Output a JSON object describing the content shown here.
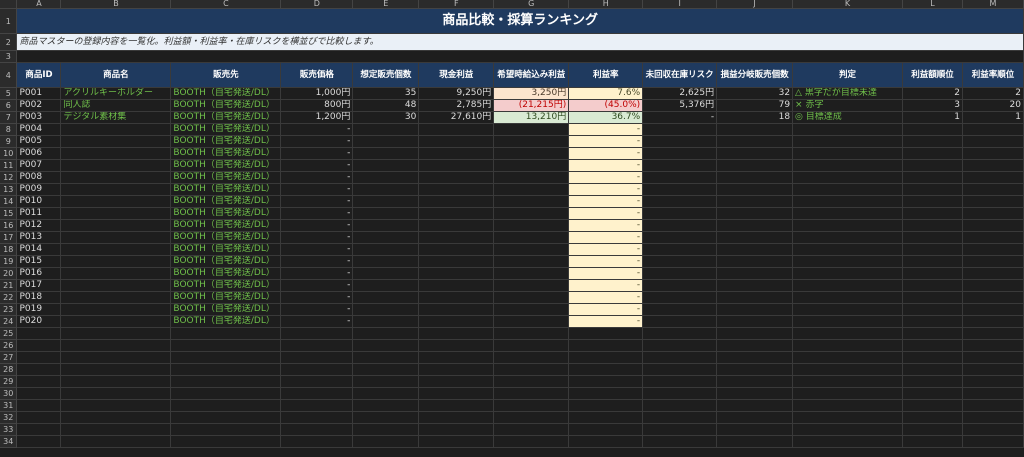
{
  "columns": [
    "A",
    "B",
    "C",
    "D",
    "E",
    "F",
    "G",
    "H",
    "I",
    "J",
    "K",
    "L",
    "M"
  ],
  "title": "商品比較・採算ランキング",
  "description": "商品マスターの登録内容を一覧化。利益額・利益率・在庫リスクを横並びで比較します。",
  "headers": [
    "商品ID",
    "商品名",
    "販売先",
    "販売価格",
    "想定販売個数",
    "現金利益",
    "希望時給込み利益",
    "利益率",
    "未回収在庫リスク",
    "損益分岐販売個数",
    "判定",
    "利益額順位",
    "利益率順位"
  ],
  "rows": [
    {
      "id": "P001",
      "name": "アクリルキーホルダー",
      "channel": "BOOTH（自宅発送/DL）",
      "price": "1,000円",
      "qty": "35",
      "cash": "9,250円",
      "wage": "3,250円",
      "rate": "7.6%",
      "risk": "2,625円",
      "be": "32",
      "judge": "△ 黒字だが目標未達",
      "r1": "2",
      "r2": "2"
    },
    {
      "id": "P002",
      "name": "同人誌",
      "channel": "BOOTH（自宅発送/DL）",
      "price": "800円",
      "qty": "48",
      "cash": "2,785円",
      "wage": "(21,215円)",
      "rate": "(45.0%)",
      "risk": "5,376円",
      "be": "79",
      "judge": "× 赤字",
      "r1": "3",
      "r2": "20"
    },
    {
      "id": "P003",
      "name": "デジタル素材集",
      "channel": "BOOTH（自宅発送/DL）",
      "price": "1,200円",
      "qty": "30",
      "cash": "27,610円",
      "wage": "13,210円",
      "rate": "36.7%",
      "risk": "-",
      "be": "18",
      "judge": "◎ 目標達成",
      "r1": "1",
      "r2": "1"
    },
    {
      "id": "P004",
      "name": "",
      "channel": "BOOTH（自宅発送/DL）",
      "price": "-",
      "qty": "",
      "cash": "",
      "wage": "",
      "rate": "-",
      "risk": "",
      "be": "",
      "judge": "",
      "r1": "",
      "r2": ""
    },
    {
      "id": "P005",
      "name": "",
      "channel": "BOOTH（自宅発送/DL）",
      "price": "-",
      "qty": "",
      "cash": "",
      "wage": "",
      "rate": "-",
      "risk": "",
      "be": "",
      "judge": "",
      "r1": "",
      "r2": ""
    },
    {
      "id": "P006",
      "name": "",
      "channel": "BOOTH（自宅発送/DL）",
      "price": "-",
      "qty": "",
      "cash": "",
      "wage": "",
      "rate": "-",
      "risk": "",
      "be": "",
      "judge": "",
      "r1": "",
      "r2": ""
    },
    {
      "id": "P007",
      "name": "",
      "channel": "BOOTH（自宅発送/DL）",
      "price": "-",
      "qty": "",
      "cash": "",
      "wage": "",
      "rate": "-",
      "risk": "",
      "be": "",
      "judge": "",
      "r1": "",
      "r2": ""
    },
    {
      "id": "P008",
      "name": "",
      "channel": "BOOTH（自宅発送/DL）",
      "price": "-",
      "qty": "",
      "cash": "",
      "wage": "",
      "rate": "-",
      "risk": "",
      "be": "",
      "judge": "",
      "r1": "",
      "r2": ""
    },
    {
      "id": "P009",
      "name": "",
      "channel": "BOOTH（自宅発送/DL）",
      "price": "-",
      "qty": "",
      "cash": "",
      "wage": "",
      "rate": "-",
      "risk": "",
      "be": "",
      "judge": "",
      "r1": "",
      "r2": ""
    },
    {
      "id": "P010",
      "name": "",
      "channel": "BOOTH（自宅発送/DL）",
      "price": "-",
      "qty": "",
      "cash": "",
      "wage": "",
      "rate": "-",
      "risk": "",
      "be": "",
      "judge": "",
      "r1": "",
      "r2": ""
    },
    {
      "id": "P011",
      "name": "",
      "channel": "BOOTH（自宅発送/DL）",
      "price": "-",
      "qty": "",
      "cash": "",
      "wage": "",
      "rate": "-",
      "risk": "",
      "be": "",
      "judge": "",
      "r1": "",
      "r2": ""
    },
    {
      "id": "P012",
      "name": "",
      "channel": "BOOTH（自宅発送/DL）",
      "price": "-",
      "qty": "",
      "cash": "",
      "wage": "",
      "rate": "-",
      "risk": "",
      "be": "",
      "judge": "",
      "r1": "",
      "r2": ""
    },
    {
      "id": "P013",
      "name": "",
      "channel": "BOOTH（自宅発送/DL）",
      "price": "-",
      "qty": "",
      "cash": "",
      "wage": "",
      "rate": "-",
      "risk": "",
      "be": "",
      "judge": "",
      "r1": "",
      "r2": ""
    },
    {
      "id": "P014",
      "name": "",
      "channel": "BOOTH（自宅発送/DL）",
      "price": "-",
      "qty": "",
      "cash": "",
      "wage": "",
      "rate": "-",
      "risk": "",
      "be": "",
      "judge": "",
      "r1": "",
      "r2": ""
    },
    {
      "id": "P015",
      "name": "",
      "channel": "BOOTH（自宅発送/DL）",
      "price": "-",
      "qty": "",
      "cash": "",
      "wage": "",
      "rate": "-",
      "risk": "",
      "be": "",
      "judge": "",
      "r1": "",
      "r2": ""
    },
    {
      "id": "P016",
      "name": "",
      "channel": "BOOTH（自宅発送/DL）",
      "price": "-",
      "qty": "",
      "cash": "",
      "wage": "",
      "rate": "-",
      "risk": "",
      "be": "",
      "judge": "",
      "r1": "",
      "r2": ""
    },
    {
      "id": "P017",
      "name": "",
      "channel": "BOOTH（自宅発送/DL）",
      "price": "-",
      "qty": "",
      "cash": "",
      "wage": "",
      "rate": "-",
      "risk": "",
      "be": "",
      "judge": "",
      "r1": "",
      "r2": ""
    },
    {
      "id": "P018",
      "name": "",
      "channel": "BOOTH（自宅発送/DL）",
      "price": "-",
      "qty": "",
      "cash": "",
      "wage": "",
      "rate": "-",
      "risk": "",
      "be": "",
      "judge": "",
      "r1": "",
      "r2": ""
    },
    {
      "id": "P019",
      "name": "",
      "channel": "BOOTH（自宅発送/DL）",
      "price": "-",
      "qty": "",
      "cash": "",
      "wage": "",
      "rate": "-",
      "risk": "",
      "be": "",
      "judge": "",
      "r1": "",
      "r2": ""
    },
    {
      "id": "P020",
      "name": "",
      "channel": "BOOTH（自宅発送/DL）",
      "price": "-",
      "qty": "",
      "cash": "",
      "wage": "",
      "rate": "-",
      "risk": "",
      "be": "",
      "judge": "",
      "r1": "",
      "r2": ""
    }
  ],
  "row_numbers": [
    "1",
    "2",
    "3",
    "4",
    "5",
    "6",
    "7",
    "8",
    "9",
    "10",
    "11",
    "12",
    "13",
    "14",
    "15",
    "16",
    "17",
    "18",
    "19",
    "20",
    "21",
    "22",
    "23",
    "24",
    "25",
    "26",
    "27",
    "28",
    "29",
    "30",
    "31",
    "32",
    "33",
    "34"
  ],
  "colors": {
    "header_bg": "#1f3a5f",
    "desc_bg": "#eaf0f7",
    "rate_bg": "#fff2cc",
    "negative_bg": "#f4cccc",
    "positive_bg": "#d9ead3",
    "text_green": "#6fbf4a"
  }
}
